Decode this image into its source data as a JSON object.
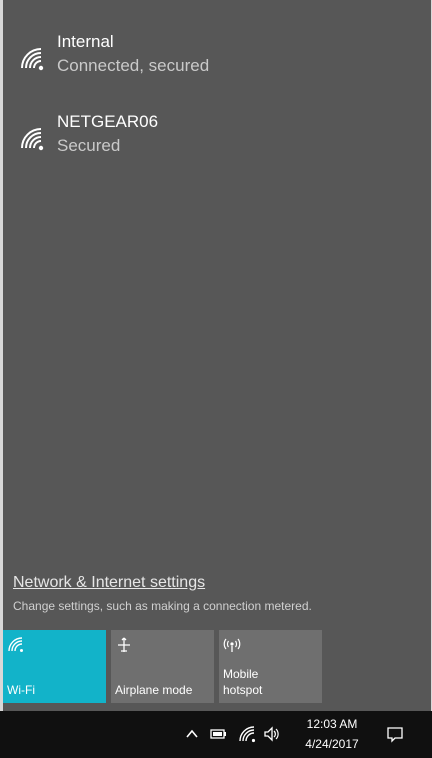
{
  "networks": [
    {
      "ssid": "Internal",
      "status": "Connected, secured"
    },
    {
      "ssid": "NETGEAR06",
      "status": "Secured"
    }
  ],
  "settings": {
    "link": "Network & Internet settings",
    "description": "Change settings, such as making a connection metered."
  },
  "quick_actions": [
    {
      "label": "Wi-Fi",
      "icon": "wifi-icon",
      "active": true
    },
    {
      "label": "Airplane mode",
      "icon": "airplane-icon",
      "active": false
    },
    {
      "label_line1": "Mobile",
      "label_line2": "hotspot",
      "icon": "hotspot-icon",
      "active": false
    }
  ],
  "taskbar": {
    "time": "12:03 AM",
    "date": "4/24/2017"
  },
  "colors": {
    "flyout_bg": "#575757",
    "accent": "#12b3c9",
    "tile_bg": "#6f6f6f",
    "taskbar_bg": "#101010"
  }
}
